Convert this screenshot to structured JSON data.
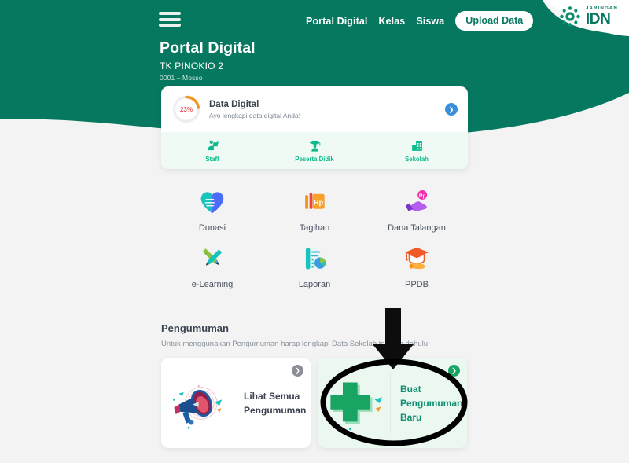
{
  "brand": {
    "logo_jaringan": "JARINGAN",
    "logo_idn": "IDN",
    "green": "#05785f",
    "accent_teal": "#0cbb8c",
    "accent_blue": "#3a8fdc",
    "accent_orange": "#f7941e",
    "progress_text_color": "#e8565a"
  },
  "topbar": {
    "menu_icon": "hamburger-icon",
    "nav": [
      {
        "label": "Portal Digital"
      },
      {
        "label": "Kelas"
      },
      {
        "label": "Siswa"
      }
    ],
    "upload_button": "Upload Data"
  },
  "page": {
    "title": "Portal Digital",
    "school": "TK PINOKIO 2",
    "code": "0001 – Mosso"
  },
  "data_card": {
    "progress_percent": "23%",
    "progress_value": 23,
    "title": "Data Digital",
    "description": "Ayo lengkapi data digital Anda!",
    "chevron_icon": "chevron-right-icon",
    "items": [
      {
        "label": "Staff",
        "icon": "staff-icon"
      },
      {
        "label": "Peserta Didik",
        "icon": "graduate-icon"
      },
      {
        "label": "Sekolah",
        "icon": "school-building-icon"
      }
    ]
  },
  "menu": [
    {
      "label": "Donasi",
      "icon": "heart-hand-icon"
    },
    {
      "label": "Tagihan",
      "icon": "rp-book-icon"
    },
    {
      "label": "Dana Talangan",
      "icon": "hand-coin-icon"
    },
    {
      "label": "e-Learning",
      "icon": "pencil-ruler-icon"
    },
    {
      "label": "Laporan",
      "icon": "report-chart-icon"
    },
    {
      "label": "PPDB",
      "icon": "graduation-cap-icon"
    }
  ],
  "announcement": {
    "section_title": "Pengumuman",
    "section_desc": "Untuk menggunakan Pengumuman harap lengkapi Data Sekolah terlebih dahulu.",
    "cards": [
      {
        "label": "Lihat Semua Pengumuman",
        "art": "megaphone-illustration",
        "chevron_icon": "chevron-right-icon"
      },
      {
        "label": "Buat Pengumuman Baru",
        "art": "plus-illustration",
        "chevron_icon": "chevron-right-icon"
      }
    ]
  },
  "annotations": {
    "arrow": "down-arrow-annotation",
    "ellipse": "ellipse-highlight-annotation"
  }
}
